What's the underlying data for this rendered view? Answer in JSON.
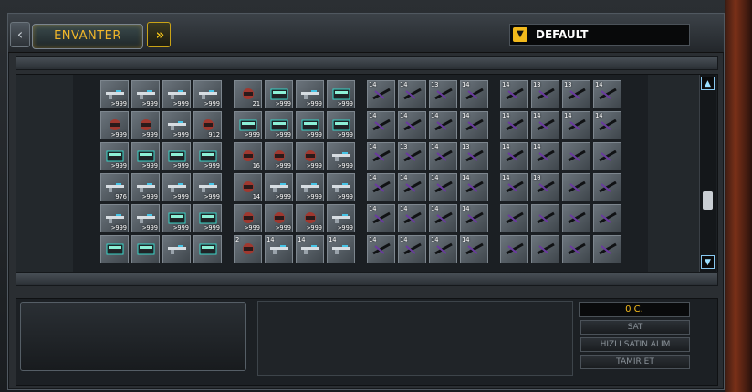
{
  "window": {
    "title": "ENVANTER",
    "nav_left_glyph": "‹",
    "nav_right_glyph": "»",
    "dropdown_value": "DEFAULT",
    "dropdown_arrow_glyph": "▼"
  },
  "inventory": {
    "panel_a": [
      {
        "qty": ">999",
        "icon": "gun-icon"
      },
      {
        "qty": ">999",
        "icon": "gun-icon"
      },
      {
        "qty": ">999",
        "icon": "gun-icon"
      },
      {
        "qty": ">999",
        "icon": "gun-icon"
      },
      {
        "qty": ">999",
        "icon": "helmet-icon"
      },
      {
        "qty": ">999",
        "icon": "mech-icon"
      },
      {
        "qty": ">999",
        "icon": "gun-icon"
      },
      {
        "qty": "912",
        "icon": "mech-icon"
      },
      {
        "qty": ">999",
        "icon": "box-icon"
      },
      {
        "qty": ">999",
        "icon": "box-icon"
      },
      {
        "qty": ">999",
        "icon": "box-icon"
      },
      {
        "qty": ">999",
        "icon": "box-icon"
      },
      {
        "qty": "976",
        "icon": "gun-icon"
      },
      {
        "qty": ">999",
        "icon": "gun-icon"
      },
      {
        "qty": ">999",
        "icon": "gun-icon"
      },
      {
        "qty": ">999",
        "icon": "gun-icon"
      },
      {
        "qty": ">999",
        "icon": "gun-icon"
      },
      {
        "qty": ">999",
        "icon": "gun-icon"
      },
      {
        "qty": ">999",
        "icon": "box-icon"
      },
      {
        "qty": ">999",
        "icon": "box-icon"
      },
      {
        "qty": "",
        "icon": "box-icon"
      },
      {
        "qty": "",
        "icon": "box-icon"
      },
      {
        "qty": "",
        "icon": "gun-icon"
      },
      {
        "qty": "",
        "icon": "box-icon"
      }
    ],
    "panel_b": [
      {
        "qty": "21",
        "icon": "mech-icon"
      },
      {
        "qty": ">999",
        "icon": "box-icon"
      },
      {
        "qty": ">999",
        "icon": "gun-icon"
      },
      {
        "qty": ">999",
        "icon": "box-icon"
      },
      {
        "qty": ">999",
        "icon": "box-icon"
      },
      {
        "qty": ">999",
        "icon": "box-icon"
      },
      {
        "qty": ">999",
        "icon": "box-icon"
      },
      {
        "qty": ">999",
        "icon": "box-icon"
      },
      {
        "qty": "16",
        "icon": "mech-icon"
      },
      {
        "qty": ">999",
        "icon": "mech-icon"
      },
      {
        "qty": ">999",
        "icon": "mech-icon"
      },
      {
        "qty": ">999",
        "icon": "gun-icon"
      },
      {
        "qty": "14",
        "icon": "mech-icon"
      },
      {
        "qty": ">999",
        "icon": "gun-icon"
      },
      {
        "qty": ">999",
        "icon": "gun-icon"
      },
      {
        "qty": ">999",
        "icon": "gun-icon"
      },
      {
        "qty": ">999",
        "icon": "mech-icon"
      },
      {
        "qty": ">999",
        "icon": "mech-icon"
      },
      {
        "qty": ">999",
        "icon": "mech-icon"
      },
      {
        "qty": ">999",
        "icon": "gun-icon"
      },
      {
        "qty": "",
        "icon": "mech-icon",
        "lvl": "2"
      },
      {
        "qty": "",
        "icon": "gun-icon",
        "lvl": "14"
      },
      {
        "qty": "",
        "icon": "gun-icon",
        "lvl": "14"
      },
      {
        "qty": "",
        "icon": "gun-icon",
        "lvl": "14"
      }
    ],
    "panel_c_levels": [
      "14",
      "14",
      "13",
      "14",
      "14",
      "14",
      "14",
      "14",
      "14",
      "13",
      "14",
      "13",
      "14",
      "14",
      "14",
      "14",
      "14",
      "14",
      "14",
      "14",
      "14",
      "14",
      "14",
      "14"
    ],
    "panel_d_levels": [
      "14",
      "13",
      "13",
      "14",
      "14",
      "14",
      "14",
      "14",
      "14",
      "14",
      "",
      "",
      "14",
      "10",
      "",
      "",
      "",
      "",
      "",
      "",
      "",
      "",
      "",
      ""
    ],
    "scroll_up_glyph": "▲",
    "scroll_down_glyph": "▼"
  },
  "footer": {
    "currency": "0 C.",
    "buttons": [
      "SAT",
      "HIZLI SATIN ALIM",
      "TAMIR ET"
    ]
  },
  "colors": {
    "accent": "#f2b91c",
    "cell": "#5d666e",
    "panel": "#1b1f23"
  }
}
